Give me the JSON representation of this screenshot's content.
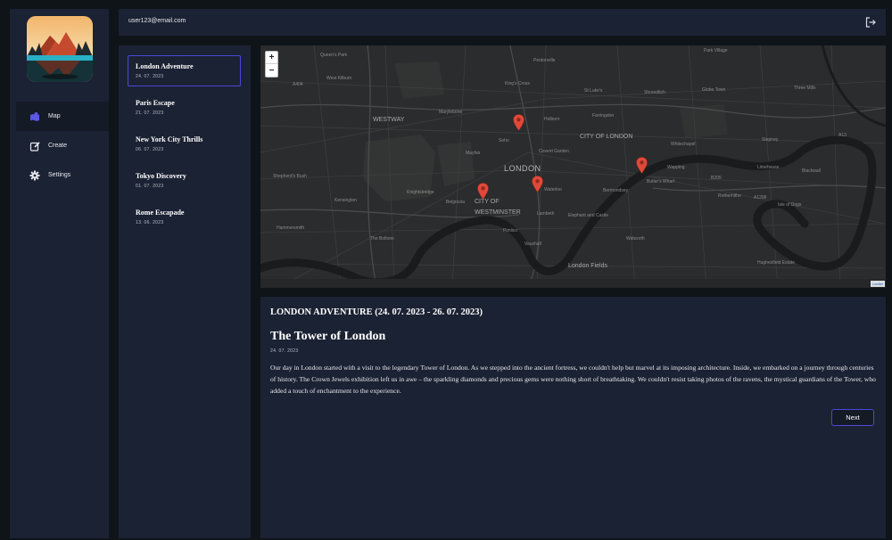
{
  "user": {
    "email": "user123@email.com"
  },
  "nav": [
    {
      "label": "Map",
      "icon": "map-icon",
      "active": true
    },
    {
      "label": "Create",
      "icon": "edit-icon",
      "active": false
    },
    {
      "label": "Settings",
      "icon": "gear-icon",
      "active": false
    }
  ],
  "trips": [
    {
      "name": "London Adventure",
      "date": "24. 07. 2023",
      "active": true
    },
    {
      "name": "Paris Escape",
      "date": "21. 07. 2023",
      "active": false
    },
    {
      "name": "New York City Thrills",
      "date": "06. 07. 2023",
      "active": false
    },
    {
      "name": "Tokyo Discovery",
      "date": "01. 07. 2023",
      "active": false
    },
    {
      "name": "Rome Escapade",
      "date": "13. 06. 2023",
      "active": false
    }
  ],
  "map": {
    "zoom_in": "+",
    "zoom_out": "−",
    "attribution": "Leaflet",
    "labels": {
      "london": "LONDON",
      "city_of_london": "CITY OF LONDON",
      "city_of": "CITY OF",
      "westminster": "WESTMINSTER",
      "westway": "WESTWAY",
      "butlers_wharf": "Butler's Wharf",
      "pentonville": "Pentonville",
      "kensington": "Kensington",
      "hammersmith": "Hammersmith",
      "the_boltons": "The Boltons",
      "london_fields": "London Fields",
      "hughesfield_estate": "Hughesfield Estate",
      "shepherds_bush": "Shepherd's Bush",
      "queens_park": "Queen's Park",
      "west_kilburn": "West Kilburn",
      "park_village": "Park Village",
      "globe_town": "Globe Town",
      "three_mills": "Three Mills",
      "soho": "Soho",
      "mayfair": "Mayfair",
      "covent_garden": "Covent Garden",
      "holborn": "Holborn",
      "farringdon": "Farringdon",
      "belgravia": "Belgravia",
      "lambeth": "Lambeth",
      "vauxhall": "Vauxhall",
      "elephant_castle": "Elephant and Castle",
      "wapping": "Wapping",
      "waterloo": "Waterloo",
      "knightsbridge": "Knightsbridge",
      "pimlico": "Pimlico",
      "stepney": "Stepney",
      "blackwall": "Blackwall",
      "isle_of_dogs": "Isle of Dogs",
      "whitechapel": "Whitechapel",
      "bermondsey": "Bermondsey",
      "rotherhithe": "Rotherhithe",
      "walworth": "Walworth",
      "limehouse": "Limehouse",
      "marylebone": "Marylebone",
      "kings_cross": "King's Cross",
      "st_lukes": "St Luke's",
      "shoreditch": "Shoreditch",
      "a404": "A404",
      "a13": "A13",
      "b205": "B205",
      "a1206": "A1206"
    },
    "marker_color": "#e0493a"
  },
  "details": {
    "heading": "LONDON ADVENTURE (24. 07. 2023 - 26. 07. 2023)",
    "title": "The Tower of London",
    "date": "24. 07. 2023",
    "text": "Our day in London started with a visit to the legendary Tower of London. As we stepped into the ancient fortress, we couldn't help but marvel at its imposing architecture. Inside, we embarked on a journey through centuries of history. The Crown Jewels exhibition left us in awe – the sparkling diamonds and precious gems were nothing short of breathtaking. We couldn't resist taking photos of the ravens, the mystical guardians of the Tower, who added a touch of enchantment to the experience.",
    "next_label": "Next"
  },
  "colors": {
    "accent": "#4b48d8",
    "panel": "#1b2233",
    "background": "#0f1419"
  }
}
